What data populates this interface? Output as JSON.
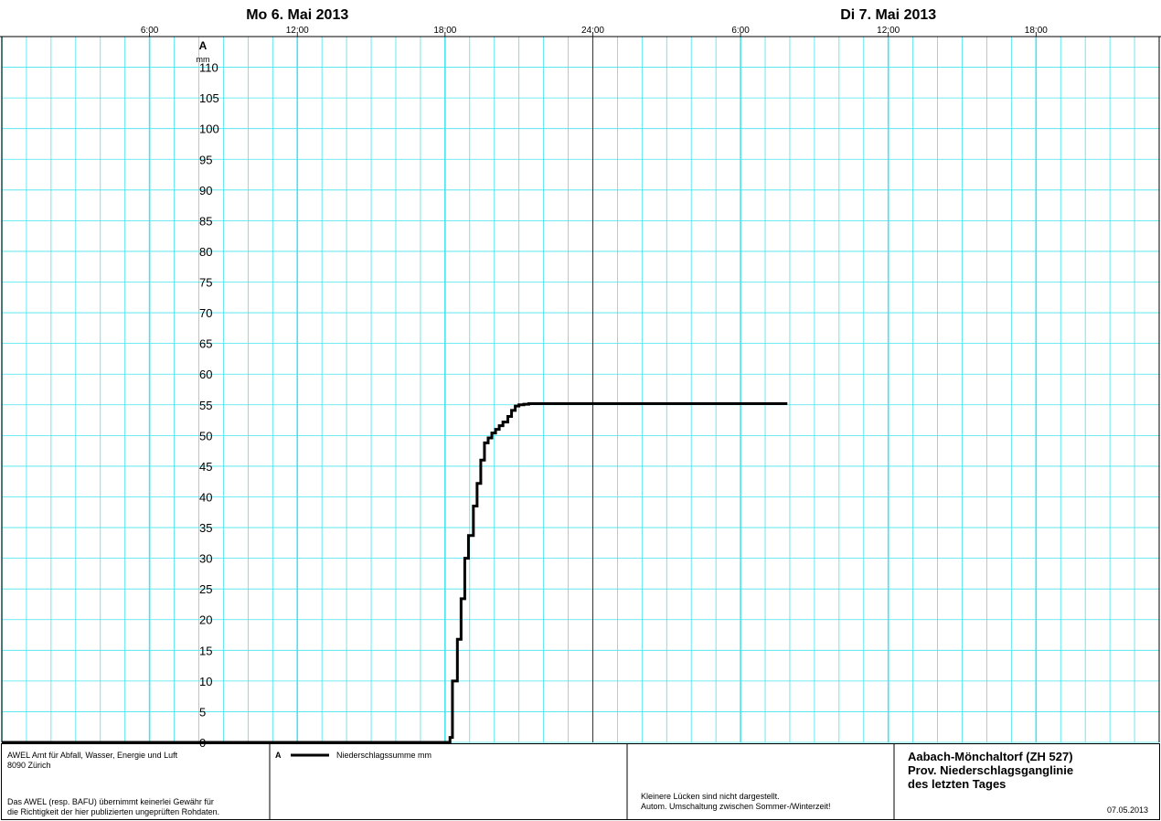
{
  "chart_data": {
    "type": "line",
    "day_labels": [
      "Mo  6. Mai  2013",
      "Di  7. Mai  2013"
    ],
    "time_tick_labels": [
      "6:00",
      "12:00",
      "18:00",
      "24:00",
      "6:00",
      "12:00",
      "18:00"
    ],
    "x_range_hours": [
      0,
      47
    ],
    "axis_letter": "A",
    "yunit": "mm",
    "ylim": [
      0,
      115
    ],
    "y_tick_values": [
      0,
      5,
      10,
      15,
      20,
      25,
      30,
      35,
      40,
      45,
      50,
      55,
      60,
      65,
      70,
      75,
      80,
      85,
      90,
      95,
      100,
      105,
      110
    ],
    "grid": true,
    "series": [
      {
        "name": "Niederschlagssumme mm",
        "step": true,
        "x_hours": [
          0,
          18.0,
          18.2,
          18.3,
          18.5,
          18.65,
          18.8,
          18.95,
          19.15,
          19.3,
          19.45,
          19.6,
          19.75,
          19.9,
          20.05,
          20.2,
          20.35,
          20.55,
          20.7,
          20.85,
          21.0,
          21.2,
          21.4,
          21.6,
          22.0,
          23.0,
          24.0,
          30.0,
          31.9
        ],
        "values_mm": [
          0,
          0,
          0.8,
          10,
          16.8,
          23.4,
          30,
          33.7,
          38.5,
          42.2,
          46,
          48.8,
          49.6,
          50.4,
          51.0,
          51.6,
          52.2,
          53.1,
          54.1,
          54.8,
          55.0,
          55.1,
          55.2,
          55.2,
          55.2,
          55.2,
          55.2,
          55.2,
          55.2
        ]
      }
    ]
  },
  "footer": {
    "org_line1": "AWEL  Amt für Abfall, Wasser, Energie und Luft",
    "org_line2": "8090 Zürich",
    "disclaimer_line1": "Das AWEL (resp. BAFU) übernimmt keinerlei Gewähr für",
    "disclaimer_line2": "die Richtigkeit der hier publizierten ungeprüften Rohdaten.",
    "legend_letter": "A",
    "legend_label": "Niederschlagssumme mm",
    "note_line1": "Kleinere Lücken sind nicht dargestellt.",
    "note_line2": "Autom. Umschaltung zwischen Sommer-/Winterzeit!",
    "station_line1": "Aabach-Mönchaltorf (ZH 527)",
    "station_line2": "Prov. Niederschlagsganglinie",
    "station_line3": "des letzten Tages",
    "date": "07.05.2013"
  }
}
